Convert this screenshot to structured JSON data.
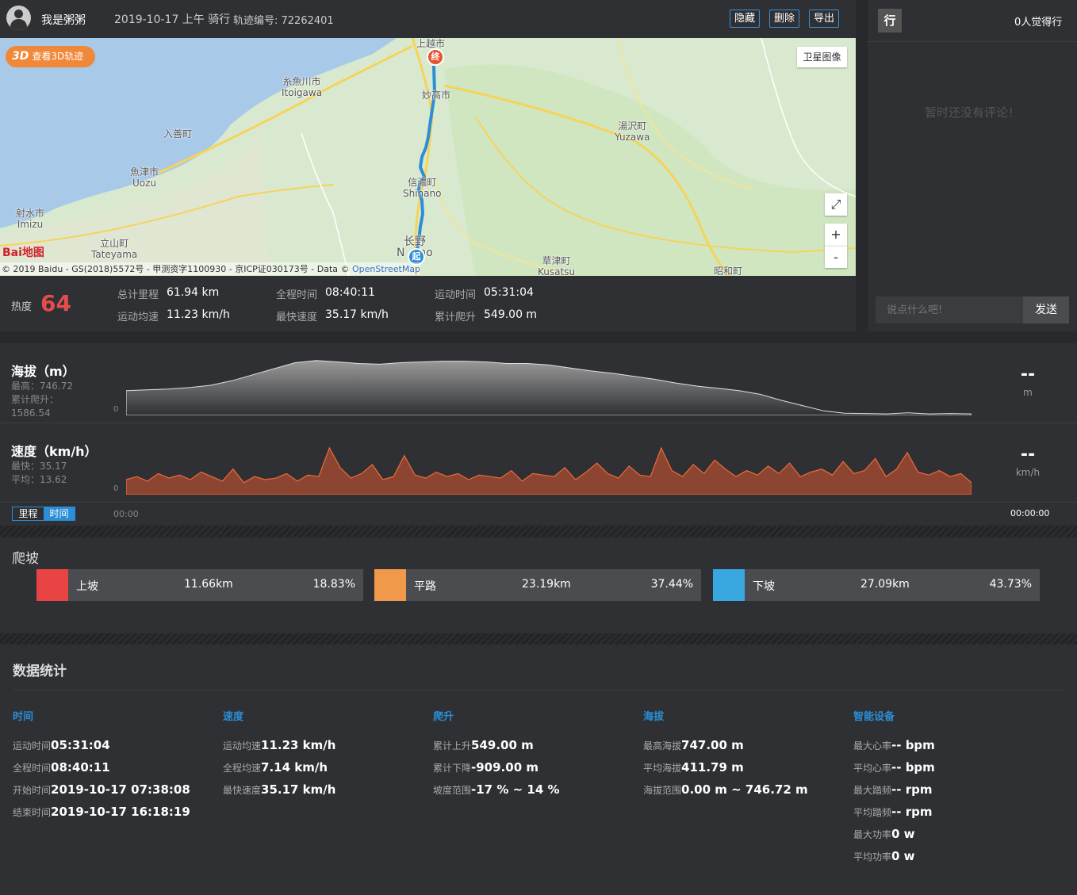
{
  "header": {
    "username": "我是粥粥",
    "ride_info": "2019-10-17 上午 骑行",
    "track_label": "轨迹编号: 72262401",
    "hide_btn": "隐藏",
    "delete_btn": "删除",
    "export_btn": "导出"
  },
  "map": {
    "btn3d_badge": "3D",
    "btn3d_label": "查看3D轨迹",
    "satellite_btn": "卫星图像",
    "fullscreen_icon": "⤢",
    "zoom_in": "+",
    "zoom_out": "-",
    "copyright": "© 2019 Baidu - GS(2018)5572号 - 甲测资字1100930 - 京ICP证030173号 - Data © ",
    "copyright_link": "OpenStreetMap",
    "logo": "Bai地图",
    "start_marker": "起",
    "end_marker": "终",
    "places": [
      {
        "id": "joetsu",
        "name": "上越市"
      },
      {
        "id": "itoigawa",
        "name": "糸魚川市\nItoigawa"
      },
      {
        "id": "myoko",
        "name": "妙高市"
      },
      {
        "id": "yuzawa",
        "name": "湯沢町\nYuzawa"
      },
      {
        "id": "nyuzen",
        "name": "入善町"
      },
      {
        "id": "uozu",
        "name": "魚津市\nUozu"
      },
      {
        "id": "shinano",
        "name": "信濃町\nShinano"
      },
      {
        "id": "imizu",
        "name": "射水市\nImizu"
      },
      {
        "id": "tateyama",
        "name": "立山町\nTateyama"
      },
      {
        "id": "nagano",
        "name": "长野\nN    no"
      },
      {
        "id": "kusatsu",
        "name": "草津町\nKusatsu"
      },
      {
        "id": "showa",
        "name": "昭和町"
      }
    ]
  },
  "stats": {
    "heat_label": "热度",
    "heat_value": "64",
    "items": [
      {
        "label": "总计里程",
        "value": "61.94  km"
      },
      {
        "label": "全程时间",
        "value": "08:40:11"
      },
      {
        "label": "运动时间",
        "value": "05:31:04"
      },
      {
        "label": "运动均速",
        "value": "11.23  km/h"
      },
      {
        "label": "最快速度",
        "value": "35.17  km/h"
      },
      {
        "label": "累计爬升",
        "value": "549.00  m"
      }
    ]
  },
  "side": {
    "icon_label": "行",
    "likes": "0人觉得行",
    "no_comment": "暂时还没有评论！",
    "comment_placeholder": "说点什么吧!",
    "send_btn": "发送"
  },
  "charts": {
    "altitude": {
      "title": "海拔（m）",
      "max": "最高：746.72",
      "climb_label": "累计爬升：",
      "climb_value": "1586.54",
      "zero": "0",
      "dash": "--",
      "unit": "m"
    },
    "speed": {
      "title": "速度（km/h）",
      "max": "最快：35.17",
      "avg": "平均：13.62",
      "zero": "0",
      "dash": "--",
      "unit": "km/h"
    },
    "toggle_distance": "里程",
    "toggle_time": "时间",
    "time_start": "00:00",
    "time_end": "00:00:00"
  },
  "chart_data": [
    {
      "type": "area",
      "title": "海拔（m）",
      "ylim": [
        0,
        800
      ],
      "x": [
        0,
        1,
        2,
        3,
        4,
        5,
        6,
        7,
        8,
        9,
        10,
        11,
        12,
        13,
        14,
        15,
        16,
        17,
        18,
        19,
        20,
        21,
        22,
        23,
        24,
        25,
        26,
        27,
        28,
        29,
        30,
        31,
        32,
        33,
        34,
        35,
        36,
        37,
        38,
        39,
        40
      ],
      "values": [
        330,
        340,
        350,
        370,
        400,
        460,
        540,
        620,
        700,
        730,
        710,
        690,
        680,
        700,
        710,
        720,
        720,
        710,
        690,
        690,
        670,
        630,
        590,
        560,
        520,
        480,
        430,
        390,
        360,
        330,
        280,
        200,
        130,
        60,
        30,
        25,
        20,
        35,
        20,
        25,
        20
      ]
    },
    {
      "type": "area",
      "title": "速度（km/h）",
      "ylim": [
        0,
        40
      ],
      "x": [
        0,
        1,
        2,
        3,
        4,
        5,
        6,
        7,
        8,
        9,
        10,
        11,
        12,
        13,
        14,
        15,
        16,
        17,
        18,
        19,
        20,
        21,
        22,
        23,
        24,
        25,
        26,
        27,
        28,
        29,
        30,
        31,
        32,
        33,
        34,
        35,
        36,
        37,
        38,
        39,
        40,
        41,
        42,
        43,
        44,
        45,
        46,
        47,
        48,
        49,
        50,
        51,
        52,
        53,
        54,
        55,
        56,
        57,
        58,
        59,
        60,
        61,
        62,
        63,
        64,
        65,
        66,
        67,
        68,
        69,
        70,
        71,
        72,
        73,
        74,
        75,
        76,
        77,
        78,
        79
      ],
      "values": [
        10,
        12,
        9,
        14,
        11,
        13,
        10,
        15,
        12,
        9,
        17,
        8,
        12,
        10,
        11,
        14,
        9,
        13,
        12,
        31,
        18,
        11,
        14,
        20,
        10,
        12,
        26,
        13,
        11,
        15,
        12,
        14,
        10,
        13,
        12,
        11,
        16,
        9,
        14,
        13,
        12,
        18,
        10,
        15,
        21,
        14,
        11,
        19,
        13,
        12,
        31,
        16,
        12,
        20,
        14,
        23,
        17,
        12,
        16,
        13,
        19,
        14,
        21,
        12,
        15,
        17,
        13,
        22,
        14,
        16,
        24,
        12,
        17,
        28,
        15,
        13,
        16,
        12,
        14,
        8
      ]
    }
  ],
  "climb": {
    "title": "爬坡",
    "up": {
      "name": "上坡",
      "km": "11.66km",
      "pct": "18.83%",
      "color": "#e84444"
    },
    "flat": {
      "name": "平路",
      "km": "23.19km",
      "pct": "37.44%",
      "color": "#f0994a"
    },
    "down": {
      "name": "下坡",
      "km": "27.09km",
      "pct": "43.73%",
      "color": "#3aa8e0"
    }
  },
  "data_stats": {
    "title": "数据统计",
    "time": {
      "heading": "时间",
      "rows": [
        {
          "k": "运动时间",
          "v": "05:31:04"
        },
        {
          "k": "全程时间",
          "v": "08:40:11"
        },
        {
          "k": "开始时间",
          "v": "2019-10-17 07:38:08"
        },
        {
          "k": "结束时间",
          "v": "2019-10-17 16:18:19"
        }
      ]
    },
    "speed": {
      "heading": "速度",
      "rows": [
        {
          "k": "运动均速",
          "v": "11.23 km/h"
        },
        {
          "k": "全程均速",
          "v": "7.14 km/h"
        },
        {
          "k": "最快速度",
          "v": "35.17 km/h"
        }
      ]
    },
    "climb": {
      "heading": "爬升",
      "rows": [
        {
          "k": "累计上升",
          "v": "549.00 m"
        },
        {
          "k": "累计下降",
          "v": "-909.00 m"
        },
        {
          "k": "坡度范围",
          "v": "-17 % ~ 14 %"
        }
      ]
    },
    "altitude": {
      "heading": "海拔",
      "rows": [
        {
          "k": "最高海拔",
          "v": "747.00 m"
        },
        {
          "k": "平均海拔",
          "v": "411.79 m"
        },
        {
          "k": "海拔范围",
          "v": "0.00 m ~ 746.72 m"
        }
      ]
    },
    "device": {
      "heading": "智能设备",
      "rows": [
        {
          "k": "最大心率",
          "v": "-- bpm"
        },
        {
          "k": "平均心率",
          "v": "-- bpm"
        },
        {
          "k": "最大踏频",
          "v": "-- rpm"
        },
        {
          "k": "平均踏频",
          "v": "-- rpm"
        },
        {
          "k": "最大功率",
          "v": "0 w"
        },
        {
          "k": "平均功率",
          "v": "0 w"
        }
      ]
    }
  }
}
